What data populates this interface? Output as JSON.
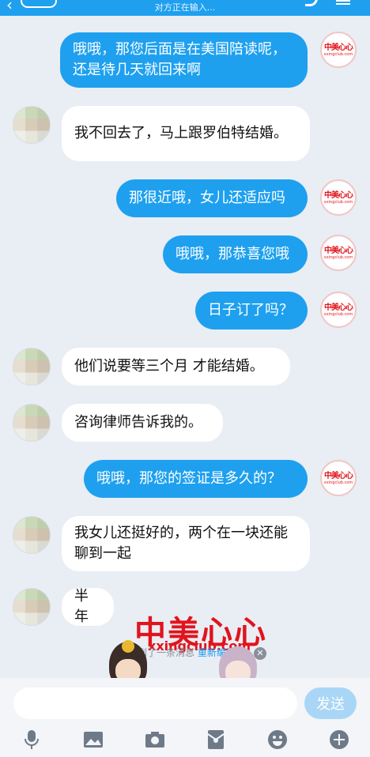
{
  "header": {
    "status": "对方正在输入..."
  },
  "brand": {
    "logo_cn": "中美心心",
    "logo_en": "xxingclub.com"
  },
  "messages": [
    {
      "side": "right",
      "text": "哦哦，那您后面是在美国陪读呢，还是待几天就回来啊"
    },
    {
      "side": "left",
      "text": "我不回去了，马上跟罗伯特结婚。"
    },
    {
      "side": "right",
      "text": "那很近哦，女儿还适应吗"
    },
    {
      "side": "right",
      "text": "哦哦，那恭喜您哦"
    },
    {
      "side": "right",
      "text": "日子订了吗？"
    },
    {
      "side": "left",
      "text": "他们说要等三个月 才能结婚。"
    },
    {
      "side": "left",
      "text": "咨询律师告诉我的。"
    },
    {
      "side": "right",
      "text": "哦哦，那您的签证是多久的？"
    },
    {
      "side": "left",
      "text": "我女儿还挺好的，两个在一块还能聊到一起"
    },
    {
      "side": "left",
      "text": "半年"
    }
  ],
  "notice": {
    "text": "你收到了一条消息",
    "link": "重新编辑"
  },
  "watermark": {
    "title": "中美心心",
    "url": "xxingclub.com"
  },
  "input": {
    "placeholder": "",
    "send_label": "发送"
  },
  "colors": {
    "accent": "#1ea0ef",
    "brand_red": "#e1141c",
    "background": "#e9edf4"
  },
  "toolbar": [
    "microphone-icon",
    "image-icon",
    "camera-icon",
    "red-packet-icon",
    "emoji-icon",
    "plus-icon"
  ]
}
